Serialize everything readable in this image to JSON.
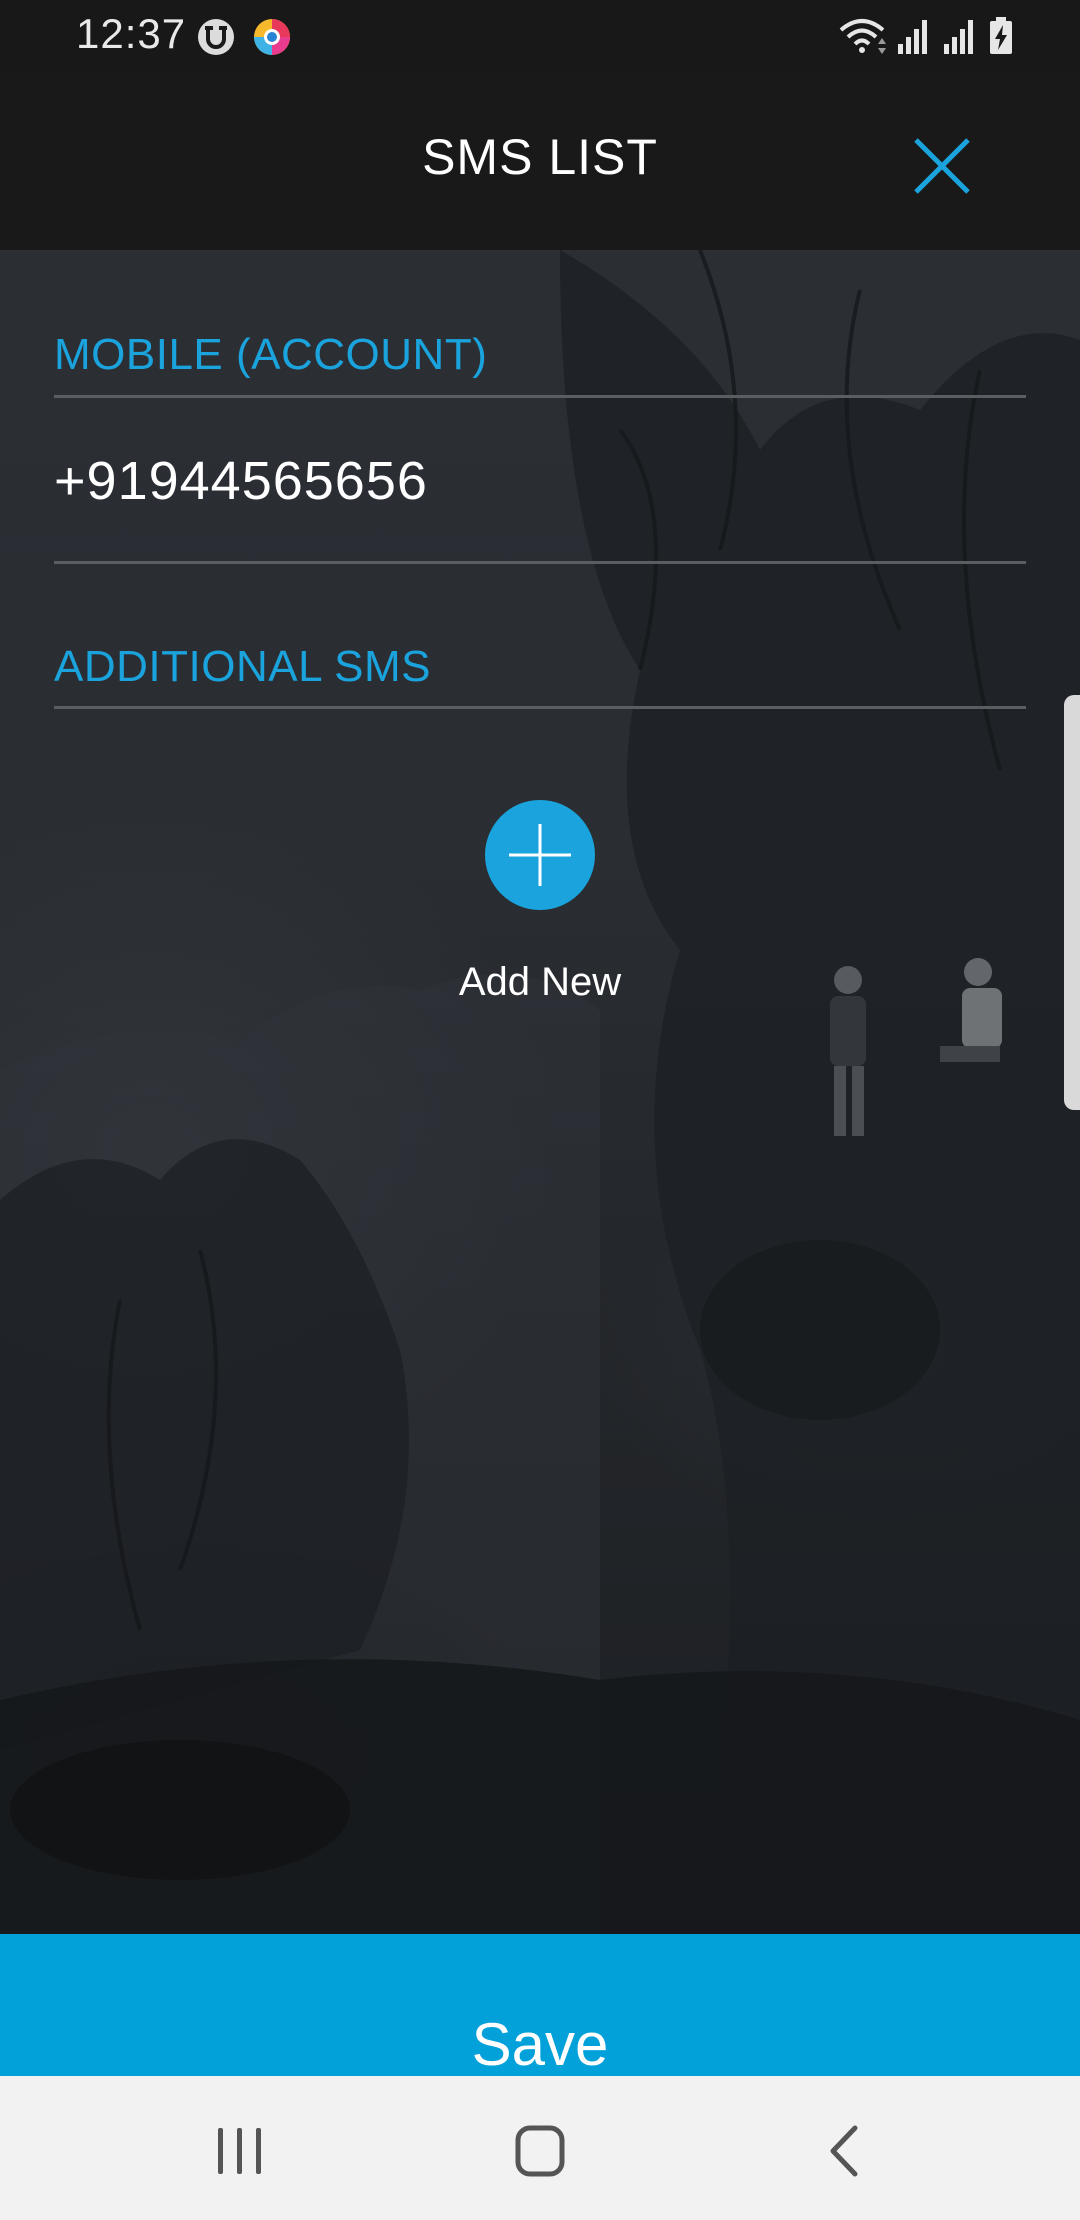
{
  "status_bar": {
    "time": "12:37",
    "icons": [
      "u-circle-icon",
      "colorful-app-icon",
      "wifi-icon",
      "signal-icon",
      "signal-icon",
      "battery-charging-icon"
    ]
  },
  "header": {
    "title": "SMS LIST",
    "close_icon": "close-icon"
  },
  "sections": {
    "mobile_label": "MOBILE (ACCOUNT)",
    "mobile_value": "+91944565656",
    "additional_label": "ADDITIONAL SMS"
  },
  "add_new": {
    "label": "Add New",
    "icon": "plus-icon"
  },
  "save": {
    "label": "Save"
  },
  "nav": {
    "icons": [
      "recents-icon",
      "home-icon",
      "back-icon"
    ]
  },
  "colors": {
    "accent": "#1aa3dc",
    "save_bar": "#03a1da",
    "header_bg": "#191919",
    "nav_bg": "#f2f2f2"
  }
}
